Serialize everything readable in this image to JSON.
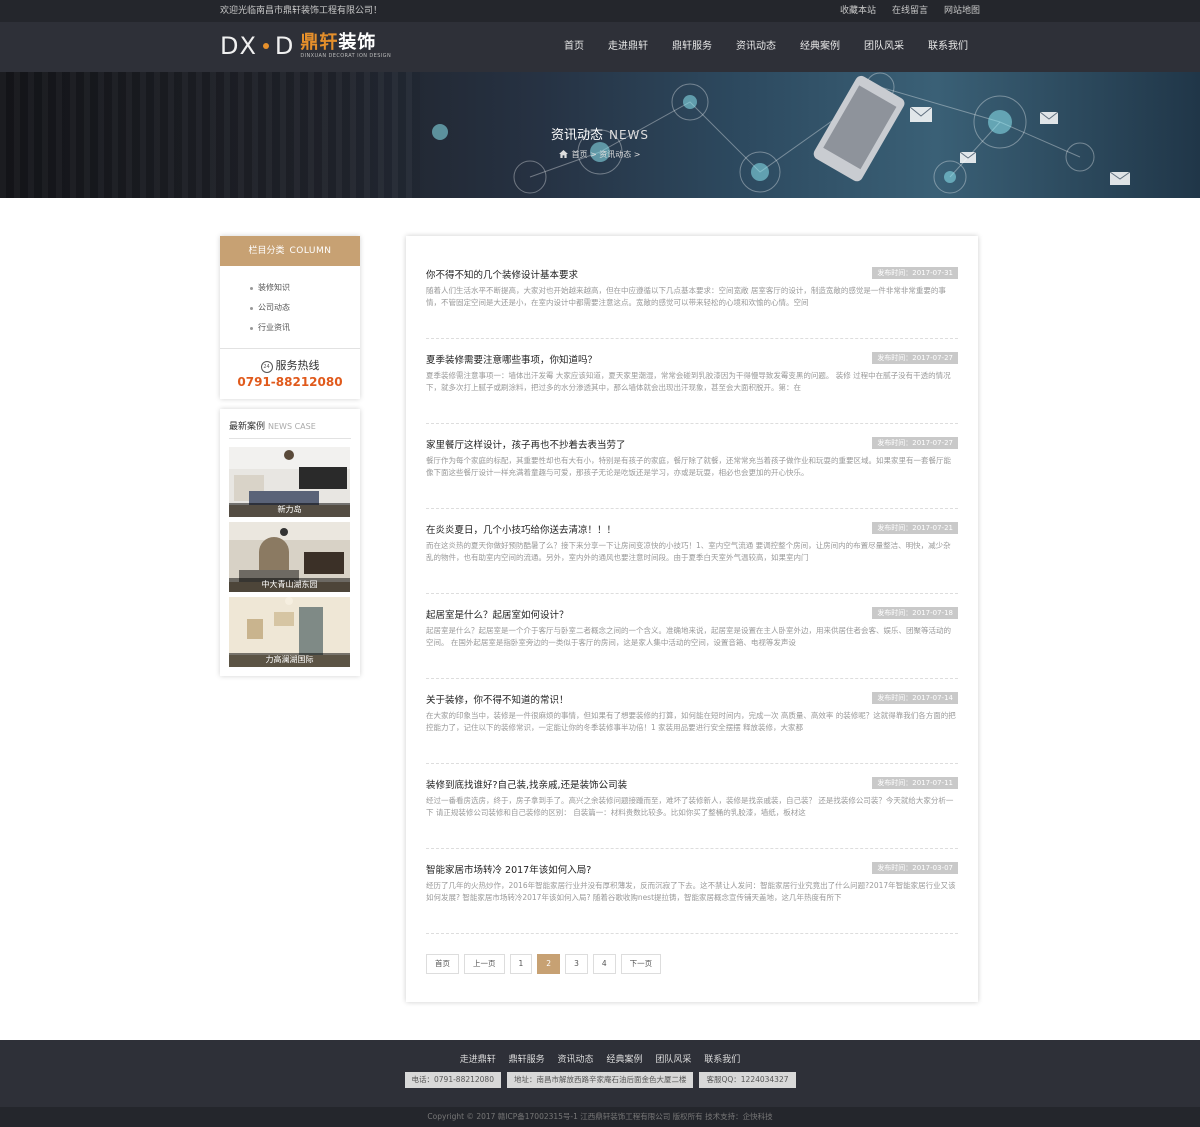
{
  "topbar": {
    "welcome": "欢迎光临南昌市鼎轩装饰工程有限公司！",
    "links": [
      "收藏本站",
      "在线留言",
      "网站地图"
    ]
  },
  "logo": {
    "dx": "DX",
    "d": "D",
    "cn_brand": "鼎轩",
    "cn_tail": "装饰",
    "en": "DINXUAN DECORAT ION DESIGN"
  },
  "nav": [
    "首页",
    "走进鼎轩",
    "鼎轩服务",
    "资讯动态",
    "经典案例",
    "团队风采",
    "联系我们"
  ],
  "banner": {
    "title": "资讯动态",
    "title_en": "NEWS",
    "crumb": "首页 > 资讯动态 >"
  },
  "sidebar": {
    "column_title": "栏目分类",
    "column_title_en": "COLUMN",
    "items": [
      "装修知识",
      "公司动态",
      "行业资讯"
    ],
    "hotline_icon": "24",
    "hotline_label": "服务热线",
    "hotline_number": "0791-88212080",
    "case_title": "最新案例",
    "case_title_en": "NEWS CASE",
    "cases": [
      "新力岛",
      "中大青山湖东园",
      "力高澜湖国际"
    ]
  },
  "news": [
    {
      "title": "你不得不知的几个装修设计基本要求",
      "date": "发布时间：2017-07-31",
      "desc": "随着人们生活水平不断提高，大家对也开始越来越高，但在中应遵循以下几点基本要求：空间宽敞 居室客厅的设计，制造宽敞的感觉是一件非常非常重要的事情，不管固定空间是大还是小，在室内设计中都需要注意这点。宽敞的感觉可以带来轻松的心境和欢愉的心情。空间"
    },
    {
      "title": "夏季装修需要注意哪些事项，你知道吗？",
      "date": "发布时间：2017-07-27",
      "desc": "夏季装修需注意事项一：墙体出汗发霉 大家应该知道，夏天家里潮湿，常常会碰到乳胶漆因为干得慢导致发霉变黑的问题。 装修 过程中在腻子没有干透的情况下，就多次打上腻子或刷涂料，把过多的水分渗透其中，那么墙体就会出现出汗现象，甚至会大面积脱开。第：在"
    },
    {
      "title": "家里餐厅这样设计，孩子再也不抄着去表当劳了",
      "date": "发布时间：2017-07-27",
      "desc": "餐厅作为每个家庭的标配，其重要性却也有大有小，特别是有孩子的家庭，餐厅除了就餐，还常常充当着孩子做作业和玩耍的重要区域。如果家里有一套餐厅能像下面这些餐厅设计一样充满着童趣与可爱，那孩子无论是吃饭还是学习，亦或是玩耍，相必也会更加的开心快乐。"
    },
    {
      "title": "在炎炎夏日，几个小技巧给你送去清凉！！！",
      "date": "发布时间：2017-07-21",
      "desc": "而在这炎热的夏天你做好预防酷暑了么？接下来分享一下让房间变凉快的小技巧！1、室内空气流通 要调控整个房间，让房间内的布置尽量整洁、明快，减少杂乱的物件，也有助室内空间的流通。另外，室内外的通风也要注意时间段。由于夏季白天室外气温较高，如果室内门"
    },
    {
      "title": "起居室是什么？起居室如何设计？",
      "date": "发布时间：2017-07-18",
      "desc": "起居室是什么？起居室是一个介于客厅与卧室二者概念之间的一个含义。准确地来说，起居室是设置在主人卧室外边，用来供居住者会客、娱乐、团聚等活动的空间。 在国外起居室是指卧室旁边的一类似于客厅的房间，这是家人集中活动的空间，设置音箱、电视等发声设"
    },
    {
      "title": "关于装修，你不得不知道的常识！",
      "date": "发布时间：2017-07-14",
      "desc": "在大家的印象当中，装修是一件很麻烦的事情，但如果有了想要装修的打算，如何能在短时间内，完成一次 高质量、高效率 的装修呢？这就得靠我们各方面的把控能力了，记住以下的装修常识，一定能让你的冬季装修事半功倍！1 家装用品要进行安全摆摆 释放装修，大家都"
    },
    {
      "title": "装修到底找谁好?自己装,找亲戚,还是装饰公司装",
      "date": "发布时间：2017-07-11",
      "desc": "经过一番看房选房，终于，房子拿到手了。高兴之余装修问题接踵而至，难坏了装修新人，装修是找亲戚装，自己装？ 还是找装修公司装？今天就给大家分析一下 请正规装修公司装修和自己装修的区别： 自装篇一：材料贵数比较多。比如你买了整桶的乳胶漆，墙纸，板材这"
    },
    {
      "title": "智能家居市场转冷 2017年该如何入局?",
      "date": "发布时间：2017-03-07",
      "desc": "经历了几年的火热炒作，2016年智能家居行业并没有厚积薄发，反而沉寂了下去。这不禁让人发问：智能家居行业究竟出了什么问题?2017年智能家居行业又该如何发展? 智能家居市场转冷2017年该如何入局? 随着谷歌收购nest提拉铸，智能家居概念宣传铺天盖地，这几年热度有所下"
    }
  ],
  "pager": {
    "first": "首页",
    "prev": "上一页",
    "pages": [
      "1",
      "2",
      "3",
      "4"
    ],
    "active": "2",
    "next": "下一页"
  },
  "footer": {
    "nav": [
      "走进鼎轩",
      "鼎轩服务",
      "资讯动态",
      "经典案例",
      "团队风采",
      "联系我们"
    ],
    "phone": "电话：0791-88212080",
    "address": "地址：南昌市解放西路辛家庵石油后面金色大厦二楼",
    "qq": "客服QQ：1224034327",
    "copyright": "Copyright © 2017 赣ICP备17002315号-1 江西鼎轩装饰工程有限公司 版权所有    技术支持：企快科技"
  },
  "colors": {
    "accent": "#c7a173",
    "hotline": "#e05a1c",
    "logo_orange": "#e6902b",
    "dark": "#2e3038"
  }
}
